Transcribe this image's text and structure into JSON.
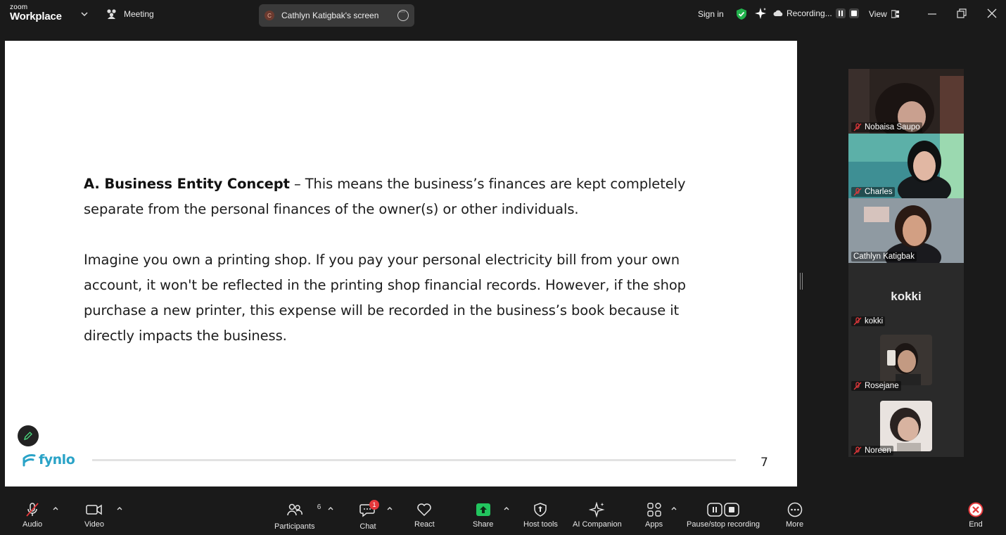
{
  "topbar": {
    "logo_small": "zoom",
    "logo_main": "Workplace",
    "meeting_label": "Meeting",
    "screen_share_avatar": "C",
    "screen_share_label": "Cathlyn Katigbak's screen",
    "sign_in": "Sign in",
    "recording_label": "Recording...",
    "view_label": "View",
    "colors": {
      "shield": "#22b14c",
      "background": "#1a1a1a"
    }
  },
  "slide": {
    "p1_bold": "A. Business Entity Concept",
    "p1_text": " – This means the business’s finances are kept completely separate from the personal finances of the owner(s) or other individuals.",
    "p2_text": "Imagine you own a printing shop. If you pay your personal electricity bill from your own account, it won't be reflected in the printing shop financial records. However, if the shop purchase a new printer, this expense will be recorded in the business’s book because it directly impacts the business.",
    "brand": "fynlo",
    "page_number": "7",
    "colors": {
      "brand": "#2aa3c7"
    }
  },
  "gallery": {
    "participants": [
      {
        "name": "Nobaisa Saupo",
        "muted": true,
        "active": false
      },
      {
        "name": "Charles",
        "muted": true,
        "active": false
      },
      {
        "name": "Cathlyn Katigbak",
        "muted": false,
        "active": true
      },
      {
        "name": "kokki",
        "muted": true,
        "active": false,
        "display_text": "kokki"
      },
      {
        "name": "Rosejane",
        "muted": true,
        "active": false
      },
      {
        "name": "Noreen",
        "muted": true,
        "active": false
      }
    ],
    "colors": {
      "active_border": "#2ecc71",
      "muted_icon": "#e5383b"
    }
  },
  "toolbar": {
    "audio": "Audio",
    "video": "Video",
    "participants": "Participants",
    "participants_count": "6",
    "chat": "Chat",
    "chat_badge": "1",
    "react": "React",
    "share": "Share",
    "host_tools": "Host tools",
    "ai_companion": "AI Companion",
    "apps": "Apps",
    "pause_stop_recording": "Pause/stop recording",
    "more": "More",
    "end": "End",
    "colors": {
      "share": "#22c55e",
      "end": "#e5383b",
      "badge": "#e5383b"
    }
  }
}
